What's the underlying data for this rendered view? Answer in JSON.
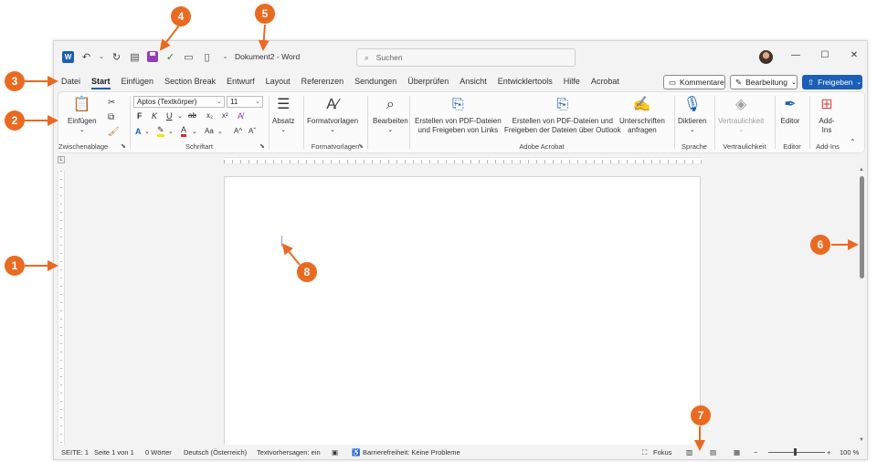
{
  "titlebar": {
    "document_title": "Dokument2",
    "app_name": "Word",
    "title_separator": "-",
    "search_placeholder": "Suchen",
    "window_controls": {
      "minimize": "—",
      "maximize": "☐",
      "close": "✕"
    }
  },
  "tabs": [
    {
      "label": "Datei"
    },
    {
      "label": "Start",
      "active": true
    },
    {
      "label": "Einfügen"
    },
    {
      "label": "Section Break"
    },
    {
      "label": "Entwurf"
    },
    {
      "label": "Layout"
    },
    {
      "label": "Referenzen"
    },
    {
      "label": "Sendungen"
    },
    {
      "label": "Überprüfen"
    },
    {
      "label": "Ansicht"
    },
    {
      "label": "Entwicklertools"
    },
    {
      "label": "Hilfe"
    },
    {
      "label": "Acrobat"
    }
  ],
  "tab_actions": {
    "comments": "Kommentare",
    "editing": "Bearbeitung",
    "share": "Freigeben"
  },
  "ribbon": {
    "clipboard": {
      "paste": "Einfügen",
      "group": "Zwischenablage"
    },
    "font": {
      "font_name": "Aptos (Textkörper)",
      "font_size": "11",
      "group": "Schriftart",
      "buttons": [
        "F",
        "K",
        "U",
        "ab",
        "x₂",
        "x²"
      ],
      "grow": "A^",
      "shrink": "Aˇ",
      "case": "Aa"
    },
    "paragraph": {
      "label": "Absatz"
    },
    "styles": {
      "label": "Formatvorlagen",
      "group": "Formatvorlagen"
    },
    "editing": {
      "label": "Bearbeiten"
    },
    "acrobat": {
      "create_share_line1": "Erstellen von PDF-Dateien",
      "create_share_line2": "und Freigeben von Links",
      "outlook_line1": "Erstellen von PDF-Dateien und",
      "outlook_line2": "Freigeben der Dateien über Outlook",
      "sign_line1": "Unterschriften",
      "sign_line2": "anfragen",
      "group": "Adobe Acrobat"
    },
    "voice": {
      "label": "Diktieren",
      "group": "Sprache"
    },
    "sensitivity": {
      "label": "Vertraulichkeit",
      "group": "Vertraulichkeit"
    },
    "editor": {
      "label": "Editor",
      "group": "Editor"
    },
    "addins": {
      "line1": "Add-",
      "line2": "Ins",
      "group": "Add-Ins"
    }
  },
  "statusbar": {
    "section": "SEITE: 1",
    "page": "Seite 1 von 1",
    "words": "0 Wörter",
    "language": "Deutsch (Österreich)",
    "predictions": "Textvorhersagen: ein",
    "accessibility": "Barrierefreiheit: Keine Probleme",
    "focus": "Fokus",
    "zoom_minus": "−",
    "zoom_plus": "+",
    "zoom": "100 %"
  },
  "callouts": [
    "1",
    "2",
    "3",
    "4",
    "5",
    "6",
    "7",
    "8"
  ],
  "colors": {
    "accent": "#1b5fb6",
    "callout": "#e96a20",
    "save_icon": "#8f3fb8"
  }
}
